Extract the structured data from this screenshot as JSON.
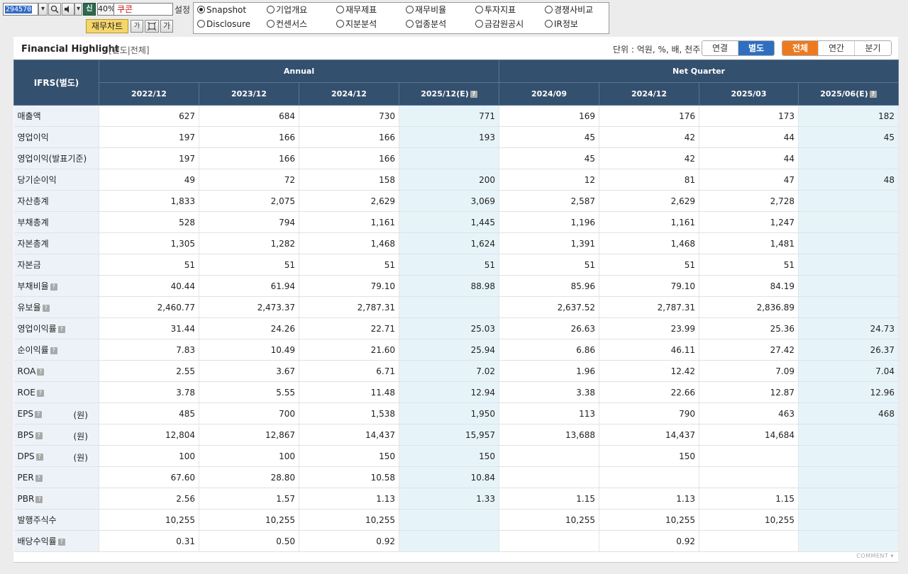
{
  "toolbar": {
    "stock_code": "294570",
    "new_label": "신",
    "zoom": "40%",
    "cookie_text": "쿠콘",
    "setting_label": "설정",
    "chart_button": "재무차트",
    "font_small": "가",
    "font_large": "가"
  },
  "menu": {
    "items": [
      {
        "label": "Snapshot",
        "checked": true
      },
      {
        "label": "기업개요",
        "checked": false
      },
      {
        "label": "재무제표",
        "checked": false
      },
      {
        "label": "재무비율",
        "checked": false
      },
      {
        "label": "투자지표",
        "checked": false
      },
      {
        "label": "경쟁사비교",
        "checked": false
      },
      {
        "label": "Disclosure",
        "checked": false
      },
      {
        "label": "컨센서스",
        "checked": false
      },
      {
        "label": "지분분석",
        "checked": false
      },
      {
        "label": "업종분석",
        "checked": false
      },
      {
        "label": "금감원공시",
        "checked": false
      },
      {
        "label": "IR정보",
        "checked": false
      }
    ]
  },
  "section": {
    "title": "Financial Highlight",
    "subtitle": "[별도|전체]",
    "unit_text": "단위 : 억원, %, 배, 천주",
    "basis_tabs": {
      "consolidated": "연결",
      "separate": "별도",
      "active": "separate"
    },
    "period_tabs": {
      "all": "전체",
      "annual": "연간",
      "quarter": "분기",
      "active": "all"
    }
  },
  "table": {
    "corner": "IFRS(별도)",
    "group_annual": "Annual",
    "group_quarter": "Net Quarter",
    "columns": [
      "2022/12",
      "2023/12",
      "2024/12",
      "2025/12(E)",
      "2024/09",
      "2024/12",
      "2025/03",
      "2025/06(E)"
    ],
    "rows": [
      {
        "label": "매출액",
        "unit": "",
        "help": false,
        "values": [
          "627",
          "684",
          "730",
          "771",
          "169",
          "176",
          "173",
          "182"
        ]
      },
      {
        "label": "영업이익",
        "unit": "",
        "help": false,
        "values": [
          "197",
          "166",
          "166",
          "193",
          "45",
          "42",
          "44",
          "45"
        ]
      },
      {
        "label": "영업이익(발표기준)",
        "unit": "",
        "help": false,
        "values": [
          "197",
          "166",
          "166",
          "",
          "45",
          "42",
          "44",
          ""
        ]
      },
      {
        "label": "당기순이익",
        "unit": "",
        "help": false,
        "values": [
          "49",
          "72",
          "158",
          "200",
          "12",
          "81",
          "47",
          "48"
        ]
      },
      {
        "label": "자산총계",
        "unit": "",
        "help": false,
        "values": [
          "1,833",
          "2,075",
          "2,629",
          "3,069",
          "2,587",
          "2,629",
          "2,728",
          ""
        ]
      },
      {
        "label": "부채총계",
        "unit": "",
        "help": false,
        "values": [
          "528",
          "794",
          "1,161",
          "1,445",
          "1,196",
          "1,161",
          "1,247",
          ""
        ]
      },
      {
        "label": "자본총계",
        "unit": "",
        "help": false,
        "values": [
          "1,305",
          "1,282",
          "1,468",
          "1,624",
          "1,391",
          "1,468",
          "1,481",
          ""
        ]
      },
      {
        "label": "자본금",
        "unit": "",
        "help": false,
        "values": [
          "51",
          "51",
          "51",
          "51",
          "51",
          "51",
          "51",
          ""
        ]
      },
      {
        "label": "부채비율",
        "unit": "",
        "help": true,
        "values": [
          "40.44",
          "61.94",
          "79.10",
          "88.98",
          "85.96",
          "79.10",
          "84.19",
          ""
        ]
      },
      {
        "label": "유보율",
        "unit": "",
        "help": true,
        "values": [
          "2,460.77",
          "2,473.37",
          "2,787.31",
          "",
          "2,637.52",
          "2,787.31",
          "2,836.89",
          ""
        ]
      },
      {
        "label": "영업이익률",
        "unit": "",
        "help": true,
        "values": [
          "31.44",
          "24.26",
          "22.71",
          "25.03",
          "26.63",
          "23.99",
          "25.36",
          "24.73"
        ]
      },
      {
        "label": "순이익률",
        "unit": "",
        "help": true,
        "values": [
          "7.83",
          "10.49",
          "21.60",
          "25.94",
          "6.86",
          "46.11",
          "27.42",
          "26.37"
        ]
      },
      {
        "label": "ROA",
        "unit": "",
        "help": true,
        "values": [
          "2.55",
          "3.67",
          "6.71",
          "7.02",
          "1.96",
          "12.42",
          "7.09",
          "7.04"
        ]
      },
      {
        "label": "ROE",
        "unit": "",
        "help": true,
        "values": [
          "3.78",
          "5.55",
          "11.48",
          "12.94",
          "3.38",
          "22.66",
          "12.87",
          "12.96"
        ]
      },
      {
        "label": "EPS",
        "unit": "(원)",
        "help": true,
        "values": [
          "485",
          "700",
          "1,538",
          "1,950",
          "113",
          "790",
          "463",
          "468"
        ]
      },
      {
        "label": "BPS",
        "unit": "(원)",
        "help": true,
        "values": [
          "12,804",
          "12,867",
          "14,437",
          "15,957",
          "13,688",
          "14,437",
          "14,684",
          ""
        ]
      },
      {
        "label": "DPS",
        "unit": "(원)",
        "help": true,
        "values": [
          "100",
          "100",
          "150",
          "150",
          "",
          "150",
          "",
          ""
        ]
      },
      {
        "label": "PER",
        "unit": "",
        "help": true,
        "values": [
          "67.60",
          "28.80",
          "10.58",
          "10.84",
          "",
          "",
          "",
          ""
        ]
      },
      {
        "label": "PBR",
        "unit": "",
        "help": true,
        "values": [
          "2.56",
          "1.57",
          "1.13",
          "1.33",
          "1.15",
          "1.13",
          "1.15",
          ""
        ]
      },
      {
        "label": "발행주식수",
        "unit": "",
        "help": false,
        "values": [
          "10,255",
          "10,255",
          "10,255",
          "",
          "10,255",
          "10,255",
          "10,255",
          ""
        ]
      },
      {
        "label": "배당수익률",
        "unit": "",
        "help": true,
        "values": [
          "0.31",
          "0.50",
          "0.92",
          "",
          "",
          "0.92",
          "",
          ""
        ]
      }
    ]
  },
  "footer": {
    "comment": "COMMENT"
  },
  "colors": {
    "header_bg": "#34506f",
    "label_bg": "#edf2f8",
    "estimate_bg": "#e6f4fa",
    "blue_tab": "#2f6fc0",
    "orange_tab": "#ee7a20"
  }
}
